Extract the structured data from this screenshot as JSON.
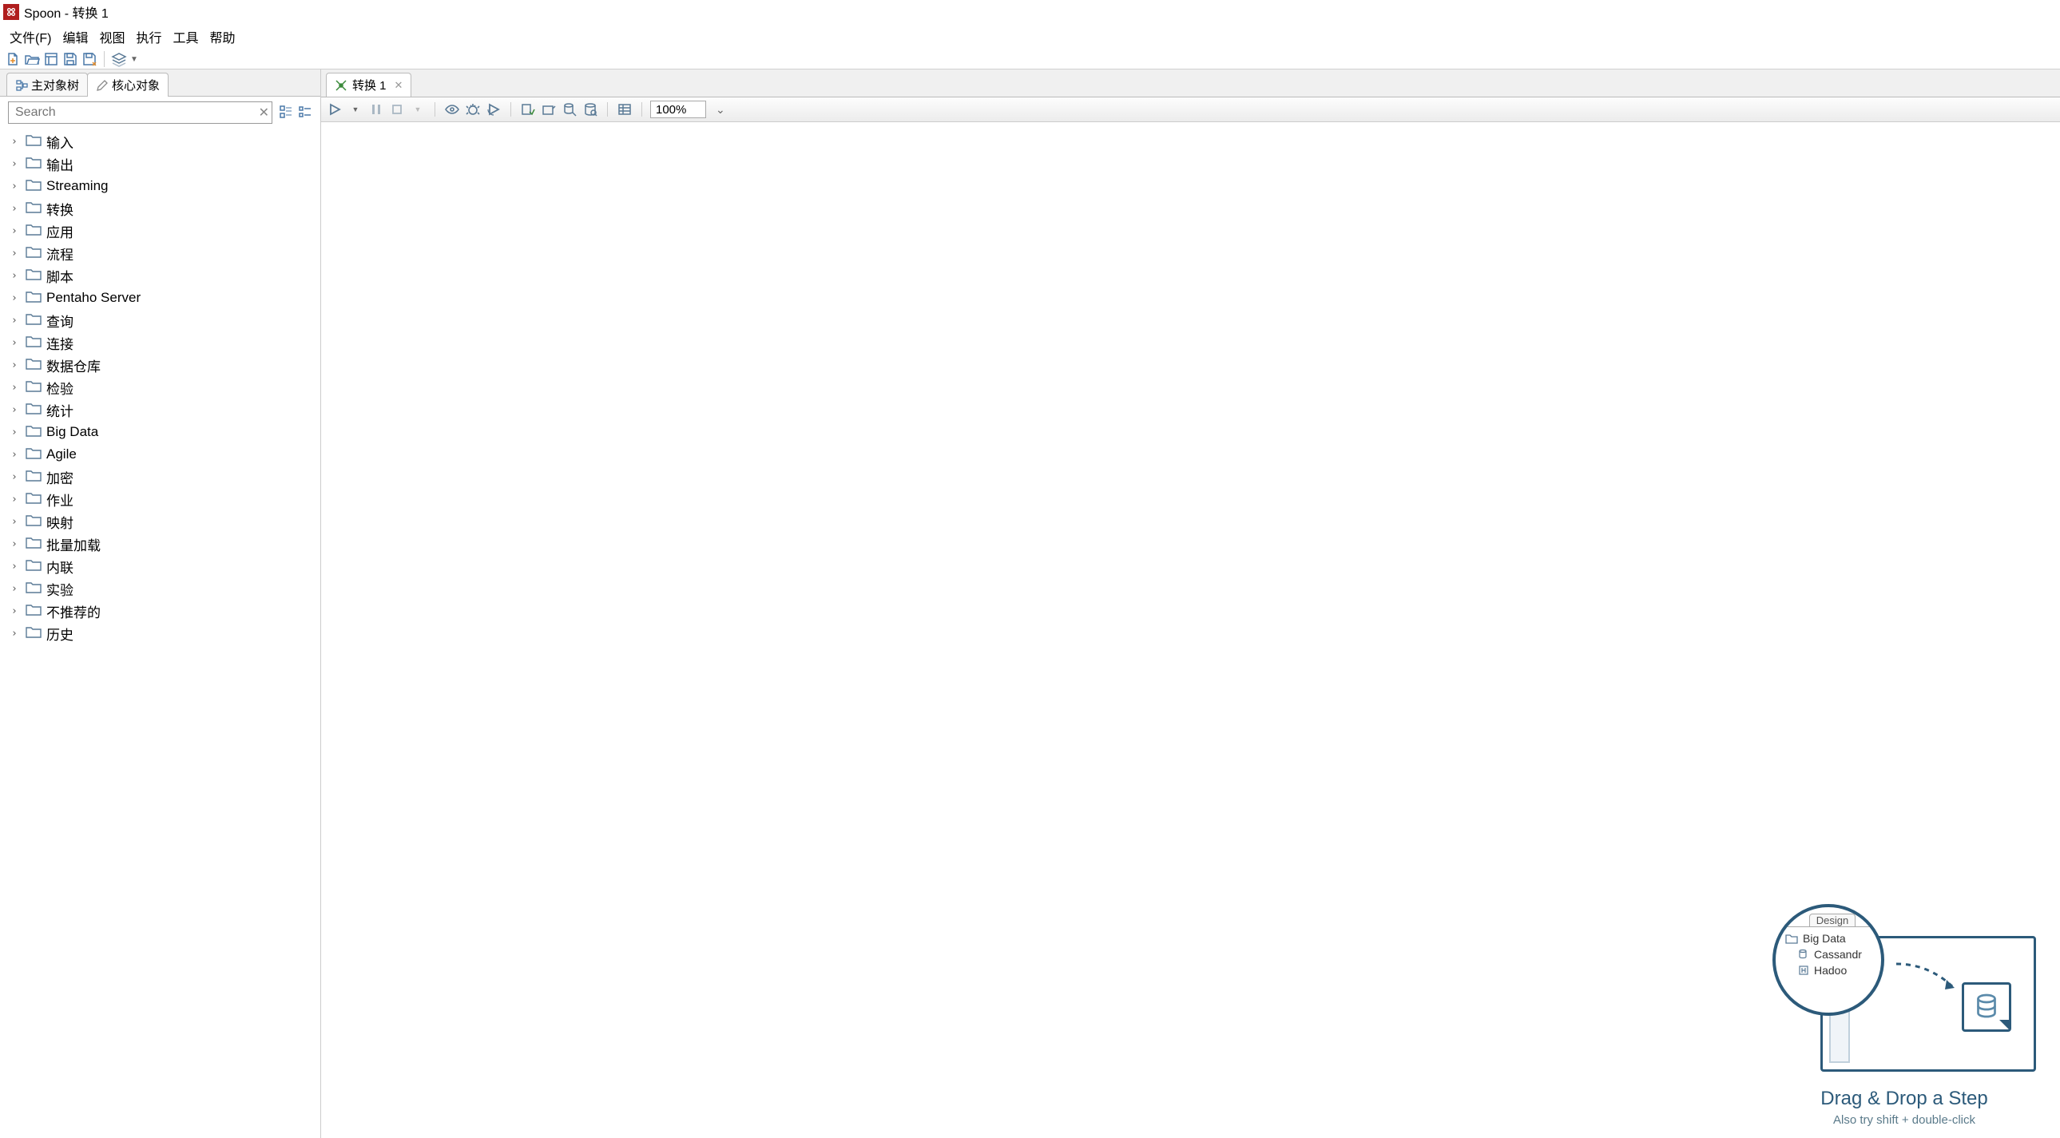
{
  "window": {
    "title": "Spoon - 转换 1"
  },
  "menu": {
    "file": "文件(F)",
    "edit": "编辑",
    "view": "视图",
    "run": "执行",
    "tools": "工具",
    "help": "帮助"
  },
  "sidebar": {
    "tabs": {
      "main_tree": "主对象树",
      "core": "核心对象"
    },
    "search_placeholder": "Search",
    "items": [
      {
        "label": "输入"
      },
      {
        "label": "输出"
      },
      {
        "label": "Streaming"
      },
      {
        "label": "转换"
      },
      {
        "label": "应用"
      },
      {
        "label": "流程"
      },
      {
        "label": "脚本"
      },
      {
        "label": "Pentaho Server"
      },
      {
        "label": "查询"
      },
      {
        "label": "连接"
      },
      {
        "label": "数据仓库"
      },
      {
        "label": "检验"
      },
      {
        "label": "统计"
      },
      {
        "label": "Big Data"
      },
      {
        "label": "Agile"
      },
      {
        "label": "加密"
      },
      {
        "label": "作业"
      },
      {
        "label": "映射"
      },
      {
        "label": "批量加载"
      },
      {
        "label": "内联"
      },
      {
        "label": "实验"
      },
      {
        "label": "不推荐的"
      },
      {
        "label": "历史"
      }
    ]
  },
  "editor": {
    "tab_label": "转换 1",
    "zoom": "100%"
  },
  "hint": {
    "design_tab": "Design",
    "row_bigdata": "Big Data",
    "row_cassandra": "Cassandr",
    "row_hadoop": "Hadoo",
    "title": "Drag & Drop a Step",
    "subtitle": "Also try shift + double-click"
  }
}
